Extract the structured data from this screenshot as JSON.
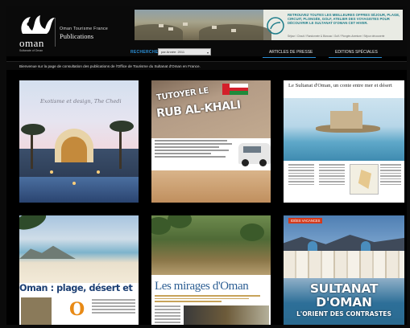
{
  "header": {
    "logo_word": "oman",
    "logo_tagline": "Sultanate of Oman",
    "brand_top": "Oman Tourisme France",
    "brand_bottom": "Publications",
    "banner_text": "RETROUVEZ TOUTES LES MEILLEURES OFFRES SÉJOUR, PLAGE, CIRCUIT, PLONGÉE, GOLF, ATELIER DES VOYAGISTES POUR DÉCOUVRIR LE SULTANAT D'OMAN CET HIVER.",
    "banner_sub": "Séjour / Circuit / Randonnée & Bivouac / Golf / Plongée-Aventure / Séjour découverte"
  },
  "nav": {
    "search_label": "RECHERCHE",
    "select_value": "par Année: 2011",
    "links": [
      "ARTICLES DE PRESSE",
      "EDITIONS SPÉCIALES"
    ]
  },
  "welcome": "Bienvenue sur la page de consultation des publications de l'Office de Tourisme du Sultanat d'Oman en France.",
  "publications": [
    {
      "caption": "Exotisme et design, The Chedi"
    },
    {
      "caption_line1": "TUTOYER LE",
      "caption_line2": "RUB AL-KHALI"
    },
    {
      "caption": "Le Sultanat d'Oman, un conte entre mer et désert"
    },
    {
      "caption": "Oman : plage, désert et"
    },
    {
      "caption": "Les mirages d'Oman"
    },
    {
      "tag": "IDÉES VACANCES",
      "caption_line1": "SULTANAT",
      "caption_line2": "D'OMAN",
      "caption_line3": "L'ORIENT DES CONTRASTES"
    }
  ],
  "colors": {
    "accent": "#2b8fd6",
    "background": "#000000",
    "banner_text": "#1e7d8a"
  }
}
